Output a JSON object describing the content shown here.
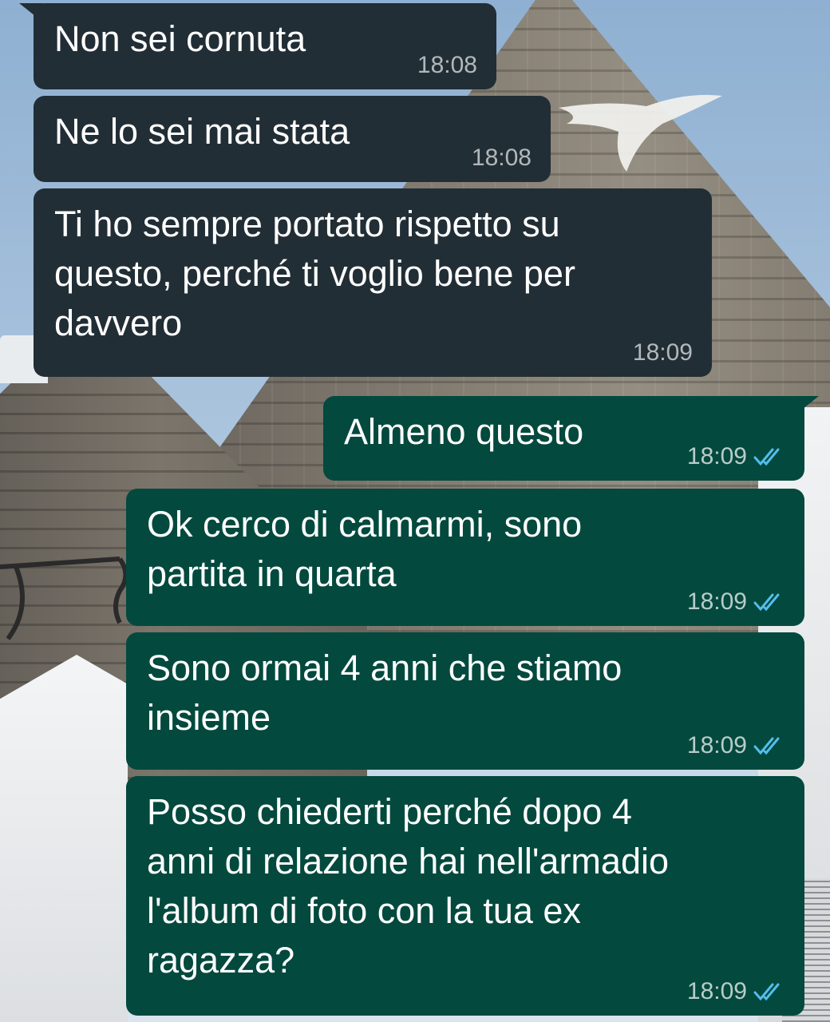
{
  "messages": [
    {
      "direction": "incoming",
      "text": "Non sei cornuta",
      "time": "18:08"
    },
    {
      "direction": "incoming",
      "text": "Ne lo sei mai stata",
      "time": "18:08"
    },
    {
      "direction": "incoming",
      "text": "Ti ho sempre portato rispetto su\nquesto, perché ti voglio bene per\ndavvero",
      "time": "18:09"
    },
    {
      "direction": "outgoing",
      "text": "Almeno questo",
      "time": "18:09",
      "status": "read"
    },
    {
      "direction": "outgoing",
      "text": "Ok cerco di calmarmi, sono\npartita in quarta",
      "time": "18:09",
      "status": "read"
    },
    {
      "direction": "outgoing",
      "text": "Sono ormai 4 anni che stiamo\ninsieme",
      "time": "18:09",
      "status": "read"
    },
    {
      "direction": "outgoing",
      "text": "Posso chiederti perché dopo 4\nanni di relazione hai nell'armadio\nl'album di foto con la tua ex\nragazza?",
      "time": "18:09",
      "status": "read"
    }
  ],
  "icons": {
    "read_receipt": "double-check-icon"
  },
  "colors": {
    "incoming_bubble": "#222e35",
    "outgoing_bubble": "#03493e",
    "read_tick": "#53bdeb",
    "text": "#ffffff"
  }
}
